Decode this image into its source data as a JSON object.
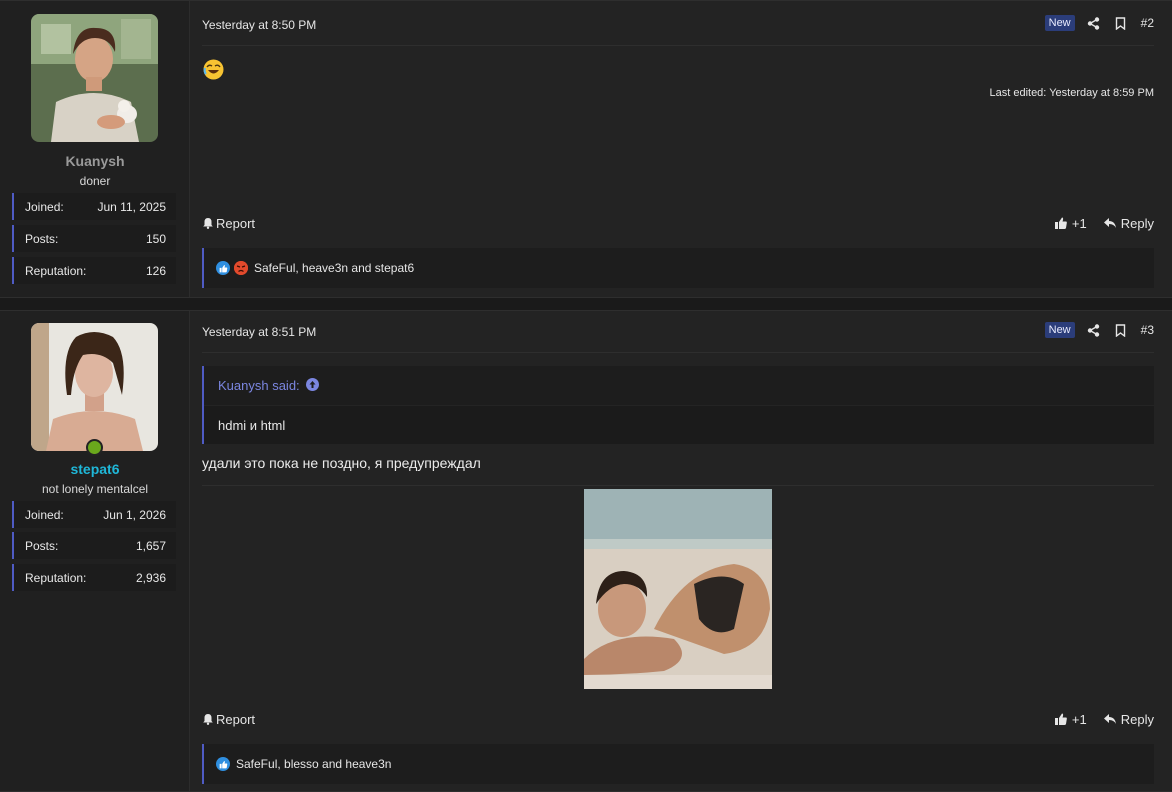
{
  "posts": [
    {
      "user": {
        "name": "Kuanysh",
        "name_color": "#9a9a9a",
        "title": "doner",
        "online": false,
        "stats": [
          {
            "label": "Joined:",
            "value": "Jun 11, 2025"
          },
          {
            "label": "Posts:",
            "value": "150"
          },
          {
            "label": "Reputation:",
            "value": "126"
          }
        ]
      },
      "date": "Yesterday at 8:50 PM",
      "badge": "New",
      "number": "#2",
      "emoji": "rolling-on-floor-laughing",
      "last_edited": "Last edited: Yesterday at 8:59 PM",
      "report_label": "Report",
      "like_label": "+1",
      "reply_label": "Reply",
      "reactions": {
        "icons": [
          "like-reaction-icon",
          "angry-reaction-icon"
        ],
        "text": "SafeFul, heave3n and stepat6"
      }
    },
    {
      "user": {
        "name": "stepat6",
        "name_color": "#1fb7d8",
        "title": "not lonely mentalcel",
        "online": true,
        "stats": [
          {
            "label": "Joined:",
            "value": "Jun 1, 2026"
          },
          {
            "label": "Posts:",
            "value": "1,657"
          },
          {
            "label": "Reputation:",
            "value": "2,936"
          }
        ]
      },
      "date": "Yesterday at 8:51 PM",
      "badge": "New",
      "number": "#3",
      "quote": {
        "author": "Kuanysh said:",
        "text": "hdmi и html"
      },
      "message": "удали это пока не поздно, я предупреждал",
      "report_label": "Report",
      "like_label": "+1",
      "reply_label": "Reply",
      "reactions": {
        "icons": [
          "like-reaction-icon"
        ],
        "text": "SafeFul, blesso and heave3n"
      }
    }
  ],
  "colors": {
    "accent": "#4f5bc4",
    "badge_bg": "#2b3d7a",
    "online": "#6aa81c"
  }
}
